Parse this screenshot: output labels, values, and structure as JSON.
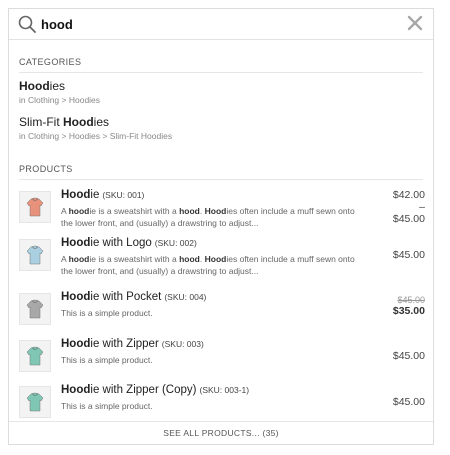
{
  "search": {
    "query": "hood",
    "icon": "search-icon",
    "clear_icon": "close-icon"
  },
  "categories": {
    "title": "CATEGORIES",
    "items": [
      {
        "name_before": "",
        "name_bold": "Hood",
        "name_after": "ies",
        "path": "in Clothing > Hoodies"
      },
      {
        "name_before": "Slim-Fit ",
        "name_bold": "Hood",
        "name_after": "ies",
        "path": "in Clothing > Hoodies > Slim-Fit Hoodies"
      }
    ]
  },
  "products": {
    "title": "PRODUCTS",
    "items": [
      {
        "name_bold": "Hood",
        "name_rest": "ie",
        "sku": "(SKU: 001)",
        "desc": [
          {
            "t": "A ",
            "b": false
          },
          {
            "t": "hood",
            "b": true
          },
          {
            "t": "ie is a sweatshirt with a ",
            "b": false
          },
          {
            "t": "hood",
            "b": true
          },
          {
            "t": ". ",
            "b": false
          },
          {
            "t": "Hood",
            "b": true
          },
          {
            "t": "ies often include a muff sewn onto the lower front, and (usually) a drawstring to adjust...",
            "b": false
          }
        ],
        "prices": [
          {
            "v": "$42.00",
            "k": "normal"
          },
          {
            "v": "–",
            "k": "normal"
          },
          {
            "v": "$45.00",
            "k": "normal"
          }
        ],
        "thumb_color": "#e8927c"
      },
      {
        "name_bold": "Hood",
        "name_rest": "ie with Logo",
        "sku": "(SKU: 002)",
        "desc": [
          {
            "t": "A ",
            "b": false
          },
          {
            "t": "hood",
            "b": true
          },
          {
            "t": "ie is a sweatshirt with a ",
            "b": false
          },
          {
            "t": "hood",
            "b": true
          },
          {
            "t": ". ",
            "b": false
          },
          {
            "t": "Hood",
            "b": true
          },
          {
            "t": "ies often include a muff sewn onto the lower front, and (usually) a drawstring to adjust...",
            "b": false
          }
        ],
        "prices": [
          {
            "v": "$45.00",
            "k": "normal"
          }
        ],
        "thumb_color": "#a9cfe0"
      },
      {
        "name_bold": "Hood",
        "name_rest": "ie with Pocket",
        "sku": "(SKU: 004)",
        "desc": [
          {
            "t": "This is a simple product.",
            "b": false
          }
        ],
        "prices": [
          {
            "v": "$45.00",
            "k": "old"
          },
          {
            "v": "$35.00",
            "k": "sale"
          }
        ],
        "thumb_color": "#a8a8a8"
      },
      {
        "name_bold": "Hood",
        "name_rest": "ie with Zipper",
        "sku": "(SKU: 003)",
        "desc": [
          {
            "t": "This is a simple product.",
            "b": false
          }
        ],
        "prices": [
          {
            "v": "$45.00",
            "k": "normal"
          }
        ],
        "thumb_color": "#7fc7b4"
      },
      {
        "name_bold": "Hood",
        "name_rest": "ie with Zipper (Copy)",
        "sku": "(SKU: 003-1)",
        "desc": [
          {
            "t": "This is a simple product.",
            "b": false
          }
        ],
        "prices": [
          {
            "v": "$45.00",
            "k": "normal"
          }
        ],
        "thumb_color": "#7fc7b4"
      }
    ]
  },
  "see_all": "SEE ALL PRODUCTS... (35)"
}
